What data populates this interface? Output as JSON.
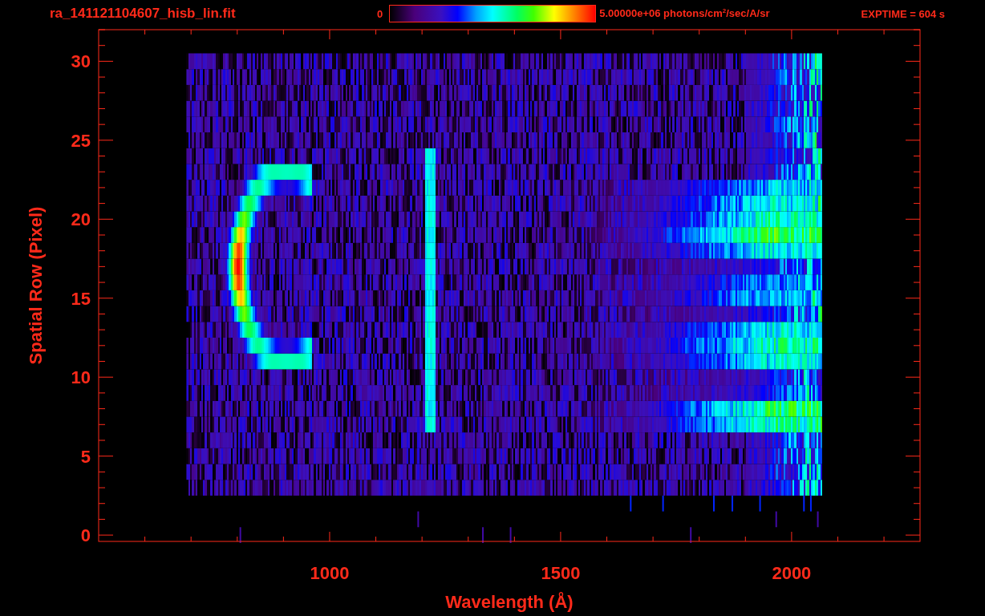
{
  "header": {
    "title": "ra_141121104607_hisb_lin.fit",
    "colorbar": {
      "min_label": "0",
      "max_label": "5.00000e+06 photons/cm$^{2}$/sec/A/sr"
    },
    "exposure": "EXPTIME = 604 s"
  },
  "plot": {
    "x_axis": {
      "label": "Wavelength (Å)",
      "ticks": [
        "1000",
        "1500",
        "2000"
      ]
    },
    "y_axis": {
      "label": "Spatial Row (Pixel)",
      "ticks": [
        "30",
        "25",
        "20",
        "15",
        "10",
        "5",
        "0"
      ]
    }
  }
}
